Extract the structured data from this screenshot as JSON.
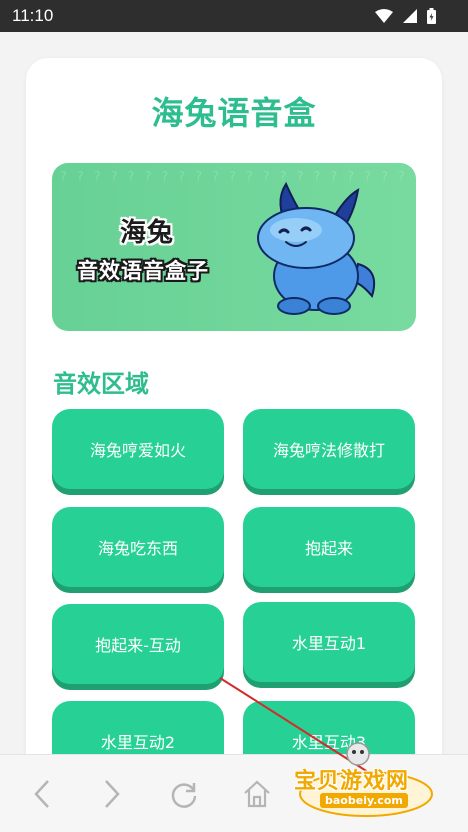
{
  "status_bar": {
    "time": "11:10",
    "icons": [
      "wifi-icon",
      "signal-icon",
      "battery-icon"
    ]
  },
  "app": {
    "title": "海兔语音盒"
  },
  "banner": {
    "line1": "海兔",
    "line2": "音效语音盒子",
    "pattern_char": "?"
  },
  "section": {
    "title": "音效区域"
  },
  "sounds": [
    {
      "label": "海兔哼爱如火"
    },
    {
      "label": "海兔哼法修散打"
    },
    {
      "label": "海兔吃东西"
    },
    {
      "label": "抱起来"
    },
    {
      "label": "抱起来-互动"
    },
    {
      "label": "水里互动1"
    },
    {
      "label": "水里互动2"
    },
    {
      "label": "水里互动3"
    }
  ],
  "nav": {
    "icons": [
      "back-arrow-icon",
      "forward-arrow-icon",
      "refresh-icon",
      "home-icon"
    ]
  },
  "watermark": {
    "text": "宝贝游戏网",
    "url": "baobeiy.com"
  },
  "colors": {
    "accent": "#2ebd8e",
    "button": "#27d196",
    "button_shadow": "#1f9f72",
    "banner": "#6fd59a"
  }
}
